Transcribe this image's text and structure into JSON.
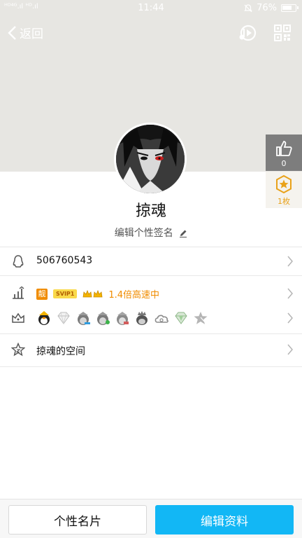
{
  "status_bar": {
    "signal": "ᴴᴰ⁴ᴳ.ıl ᴴᴰ.ıl",
    "time": "11:44",
    "battery": "76%"
  },
  "nav": {
    "back_label": "返回"
  },
  "profile": {
    "name": "掠魂",
    "signature": "编辑个性签名"
  },
  "like": {
    "count": "0"
  },
  "badge": {
    "count": "1枚"
  },
  "qq": {
    "number": "506760543"
  },
  "vip": {
    "liang": "靓",
    "svip": "SVIP1",
    "speed": "1.4倍高速中"
  },
  "space": {
    "label": "掠魂的空间"
  },
  "bottom": {
    "card_label": "个性名片",
    "edit_label": "编辑资料"
  },
  "colors": {
    "accent": "#12b7f5",
    "vip_orange": "#f08c00",
    "banner": "#e7e6e2"
  }
}
